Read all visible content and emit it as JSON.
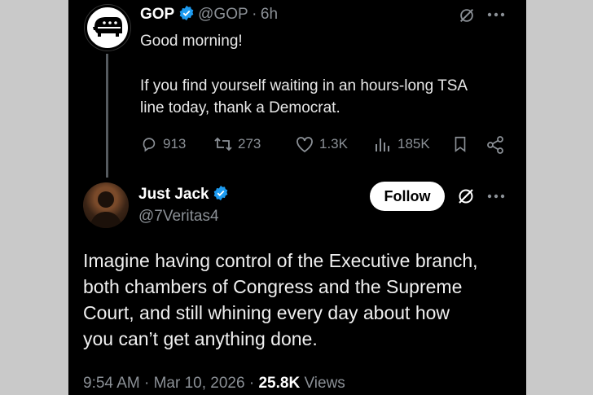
{
  "parent_tweet": {
    "name": "GOP",
    "handle": "@GOP",
    "separator": "·",
    "time": "6h",
    "text_line1": "Good morning!",
    "text_line2": "If you find yourself waiting in an hours-long TSA",
    "text_line3": "line today, thank a Democrat.",
    "replies": "913",
    "reposts": "273",
    "likes": "1.3K",
    "views": "185K"
  },
  "reply_tweet": {
    "name": "Just Jack",
    "handle": "@7Veritas4",
    "follow_label": "Follow",
    "text_lines": [
      "Imagine having control of the Executive branch,",
      "both chambers of Congress and the Supreme",
      "Court, and still whining every day about how",
      "you can’t get anything done."
    ],
    "time": "9:54 AM",
    "separator": "·",
    "date": "Mar 10, 2026",
    "views_count": "25.8K",
    "views_label": "Views"
  },
  "colors": {
    "background": "#000000",
    "verified": "#1d9bf0",
    "muted": "#8b9096"
  },
  "icons": [
    "gop-elephant-logo",
    "verified-badge-icon",
    "grok-icon",
    "more-icon",
    "reply-icon",
    "repost-icon",
    "like-icon",
    "views-icon",
    "bookmark-icon",
    "share-icon"
  ]
}
